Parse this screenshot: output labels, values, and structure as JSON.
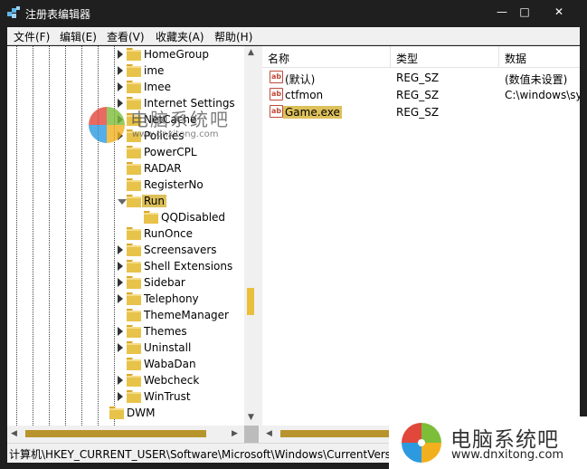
{
  "window": {
    "title": "注册表编辑器",
    "minimize_glyph": "—",
    "maximize_glyph": "□",
    "close_glyph": "✕"
  },
  "menu": [
    {
      "label": "文件(F)"
    },
    {
      "label": "编辑(E)"
    },
    {
      "label": "查看(V)"
    },
    {
      "label": "收藏夹(A)"
    },
    {
      "label": "帮助(H)"
    }
  ],
  "tree": {
    "items": [
      {
        "label": "HomeGroup",
        "expandable": true
      },
      {
        "label": "ime",
        "expandable": true
      },
      {
        "label": "Imee",
        "expandable": true
      },
      {
        "label": "Internet Settings",
        "expandable": true
      },
      {
        "label": "NetCache",
        "expandable": true
      },
      {
        "label": "Policies",
        "expandable": true
      },
      {
        "label": "PowerCPL",
        "expandable": false
      },
      {
        "label": "RADAR",
        "expandable": false
      },
      {
        "label": "RegisterNo",
        "expandable": false
      },
      {
        "label": "Run",
        "expandable": true,
        "expanded": true,
        "selected": true
      },
      {
        "label": "QQDisabled",
        "expandable": false,
        "child": true
      },
      {
        "label": "RunOnce",
        "expandable": false
      },
      {
        "label": "Screensavers",
        "expandable": true
      },
      {
        "label": "Shell Extensions",
        "expandable": true
      },
      {
        "label": "Sidebar",
        "expandable": true
      },
      {
        "label": "Telephony",
        "expandable": true
      },
      {
        "label": "ThemeManager",
        "expandable": false
      },
      {
        "label": "Themes",
        "expandable": true
      },
      {
        "label": "Uninstall",
        "expandable": true
      },
      {
        "label": "WabaDan",
        "expandable": false
      },
      {
        "label": "Webcheck",
        "expandable": true
      },
      {
        "label": "WinTrust",
        "expandable": true
      },
      {
        "label": "DWM",
        "expandable": false,
        "parent_level": true
      }
    ]
  },
  "values": {
    "columns": [
      "名称",
      "类型",
      "数据"
    ],
    "rows": [
      {
        "name": "(默认)",
        "type": "REG_SZ",
        "data": "(数值未设置)",
        "icon": "ab-string-icon"
      },
      {
        "name": "ctfmon",
        "type": "REG_SZ",
        "data": "C:\\windows\\sys",
        "icon": "ab-string-icon"
      },
      {
        "name": "Game.exe",
        "type": "REG_SZ",
        "data": "",
        "icon": "ab-string-icon",
        "selected": true
      }
    ]
  },
  "status": {
    "path": "计算机\\HKEY_CURRENT_USER\\Software\\Microsoft\\Windows\\CurrentVersion\\Ru"
  },
  "watermark": {
    "name": "电脑系统吧",
    "url": "www.dnxitong.com"
  },
  "colors": {
    "selection": "#ddc05a",
    "folder": "#e8c34a",
    "titlebar": "#1f1f1f",
    "string_icon": "#c04a3a"
  }
}
